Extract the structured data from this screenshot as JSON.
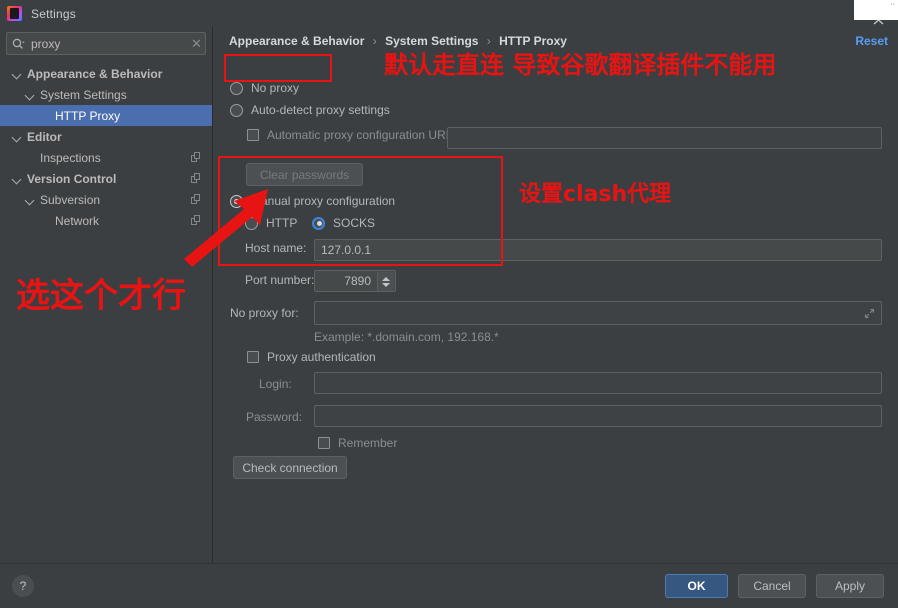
{
  "window": {
    "title": "Settings",
    "app_icon": "intellij-idea-icon"
  },
  "sidebar": {
    "search": {
      "value": "proxy",
      "placeholder": "",
      "icon": "search-icon",
      "clear_icon": "close-icon"
    },
    "tree": [
      {
        "label": "Appearance & Behavior",
        "level": 0,
        "expandable": true,
        "bold": true,
        "selected": false,
        "copy_icon": false
      },
      {
        "label": "System Settings",
        "level": 1,
        "expandable": true,
        "bold": false,
        "selected": false,
        "copy_icon": false
      },
      {
        "label": "HTTP Proxy",
        "level": 2,
        "expandable": false,
        "bold": false,
        "selected": true,
        "copy_icon": false
      },
      {
        "label": "Editor",
        "level": 0,
        "expandable": true,
        "bold": true,
        "selected": false,
        "copy_icon": false
      },
      {
        "label": "Inspections",
        "level": 1,
        "expandable": false,
        "bold": false,
        "selected": false,
        "copy_icon": true
      },
      {
        "label": "Version Control",
        "level": 0,
        "expandable": true,
        "bold": true,
        "selected": false,
        "copy_icon": true
      },
      {
        "label": "Subversion",
        "level": 1,
        "expandable": true,
        "bold": false,
        "selected": false,
        "copy_icon": true
      },
      {
        "label": "Network",
        "level": 2,
        "expandable": false,
        "bold": false,
        "selected": false,
        "copy_icon": true
      }
    ]
  },
  "main": {
    "breadcrumb": {
      "part1": "Appearance & Behavior",
      "part2": "System Settings",
      "part3": "HTTP Proxy",
      "separator": "›"
    },
    "reset_label": "Reset",
    "no_proxy": {
      "label": "No proxy",
      "selected": false
    },
    "auto_detect": {
      "label": "Auto-detect proxy settings",
      "selected": false
    },
    "auto_config_url": {
      "label": "Automatic proxy configuration URL:",
      "checked": false,
      "value": ""
    },
    "clear_passwords_label": "Clear passwords",
    "manual": {
      "label": "Manual proxy configuration",
      "selected": true
    },
    "http_radio": {
      "label": "HTTP",
      "selected": false
    },
    "socks_radio": {
      "label": "SOCKS",
      "selected": true
    },
    "host_name": {
      "label": "Host name:",
      "value": "127.0.0.1"
    },
    "port_number": {
      "label": "Port number:",
      "value": "7890"
    },
    "no_proxy_for": {
      "label": "No proxy for:",
      "value": ""
    },
    "example_hint": "Example: *.domain.com, 192.168.*",
    "proxy_auth": {
      "label": "Proxy authentication",
      "checked": false
    },
    "login": {
      "label": "Login:",
      "value": ""
    },
    "password": {
      "label": "Password:",
      "value": ""
    },
    "remember": {
      "label": "Remember",
      "checked": false
    },
    "check_connection_label": "Check connection"
  },
  "bottom": {
    "help_label": "?",
    "ok_label": "OK",
    "cancel_label": "Cancel",
    "apply_label": "Apply"
  },
  "annotations": {
    "note_top": "默认走直连 导致谷歌翻译插件不能用",
    "note_right": "设置clash代理",
    "note_left": "选这个才行"
  },
  "colors": {
    "accent_blue": "#4b6eaf",
    "link_blue": "#589df6",
    "annotation_red": "#e81313",
    "panel_bg": "#3c3f41"
  }
}
